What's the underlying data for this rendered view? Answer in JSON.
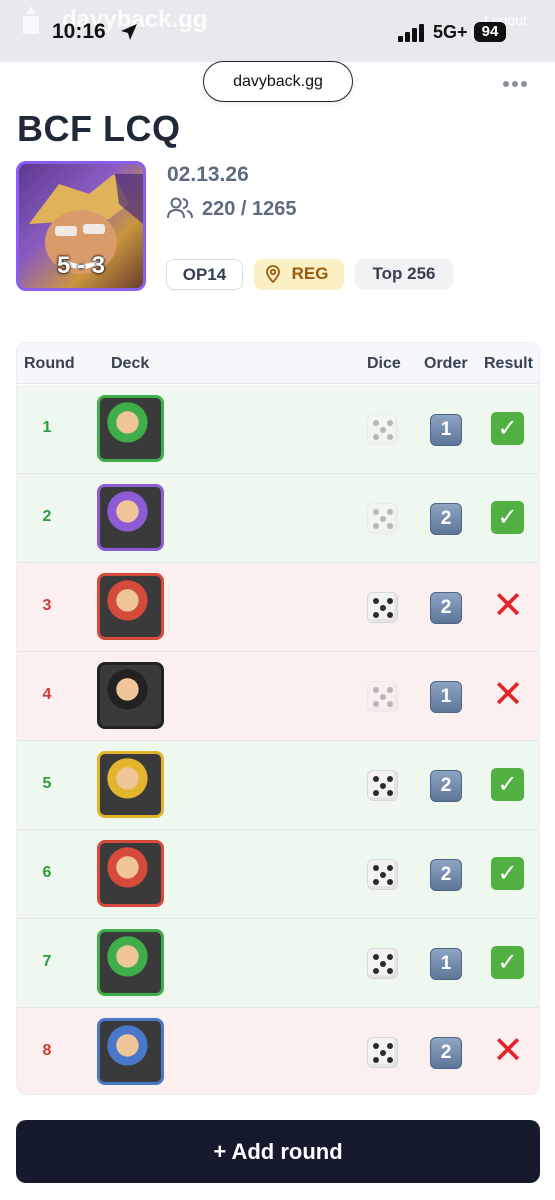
{
  "status_bar": {
    "time": "10:16",
    "network": "5G+",
    "battery": "94",
    "ghost_site_title": "davyback.gg",
    "ghost_logout": "Logout"
  },
  "browser": {
    "url": "davyback.gg"
  },
  "event": {
    "title": "BCF LCQ",
    "record": "5 - 3",
    "date": "02.13.26",
    "players": "220 / 1265",
    "tags": {
      "set": "OP14",
      "type": "REG",
      "placement": "Top 256"
    }
  },
  "table": {
    "headers": {
      "round": "Round",
      "deck": "Deck",
      "dice": "Dice",
      "order": "Order",
      "result": "Result"
    },
    "rows": [
      {
        "round": "1",
        "result": "win",
        "dice_won": false,
        "order": "1",
        "deck_color": "#3fae4a"
      },
      {
        "round": "2",
        "result": "win",
        "dice_won": false,
        "order": "2",
        "deck_color": "#8e5bd6"
      },
      {
        "round": "3",
        "result": "loss",
        "dice_won": true,
        "order": "2",
        "deck_color": "#d44b3c"
      },
      {
        "round": "4",
        "result": "loss",
        "dice_won": false,
        "order": "1",
        "deck_color": "#222222"
      },
      {
        "round": "5",
        "result": "win",
        "dice_won": true,
        "order": "2",
        "deck_color": "#e3b52c"
      },
      {
        "round": "6",
        "result": "win",
        "dice_won": true,
        "order": "2",
        "deck_color": "#d44b3c"
      },
      {
        "round": "7",
        "result": "win",
        "dice_won": true,
        "order": "1",
        "deck_color": "#3fae4a"
      },
      {
        "round": "8",
        "result": "loss",
        "dice_won": true,
        "order": "2",
        "deck_color": "#4a78c8"
      }
    ]
  },
  "actions": {
    "add_round": "+ Add round"
  },
  "colors": {
    "win_bg": "#eff8ef",
    "loss_bg": "#fbefef",
    "win_text": "#2f9a3e",
    "loss_text": "#d33b33",
    "button_bg": "#151a2d",
    "avatar_border": "#8b5cf6"
  }
}
